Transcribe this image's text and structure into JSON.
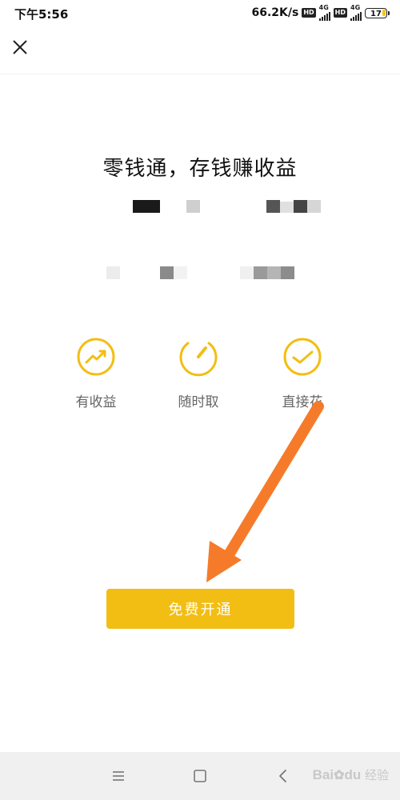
{
  "status_bar": {
    "time": "下午5:56",
    "network_speed": "66.2K/s",
    "hd_label": "HD",
    "network_type": "4G",
    "battery_level": "17"
  },
  "header": {
    "close_icon": "close-icon"
  },
  "main": {
    "headline": "零钱通，存钱赚收益",
    "features": [
      {
        "label": "有收益",
        "icon": "trending-up-icon"
      },
      {
        "label": "随时取",
        "icon": "gauge-icon"
      },
      {
        "label": "直接花",
        "icon": "check-icon"
      }
    ],
    "open_button_label": "免费开通"
  },
  "colors": {
    "accent": "#f2be14",
    "annotation_arrow": "#f57b2a"
  },
  "nav_bar": {
    "menu_icon": "menu-icon",
    "home_icon": "home-icon",
    "back_icon": "back-icon"
  },
  "watermark": {
    "brand": "Bai",
    "brand_suffix": "du",
    "sub": "经验"
  }
}
